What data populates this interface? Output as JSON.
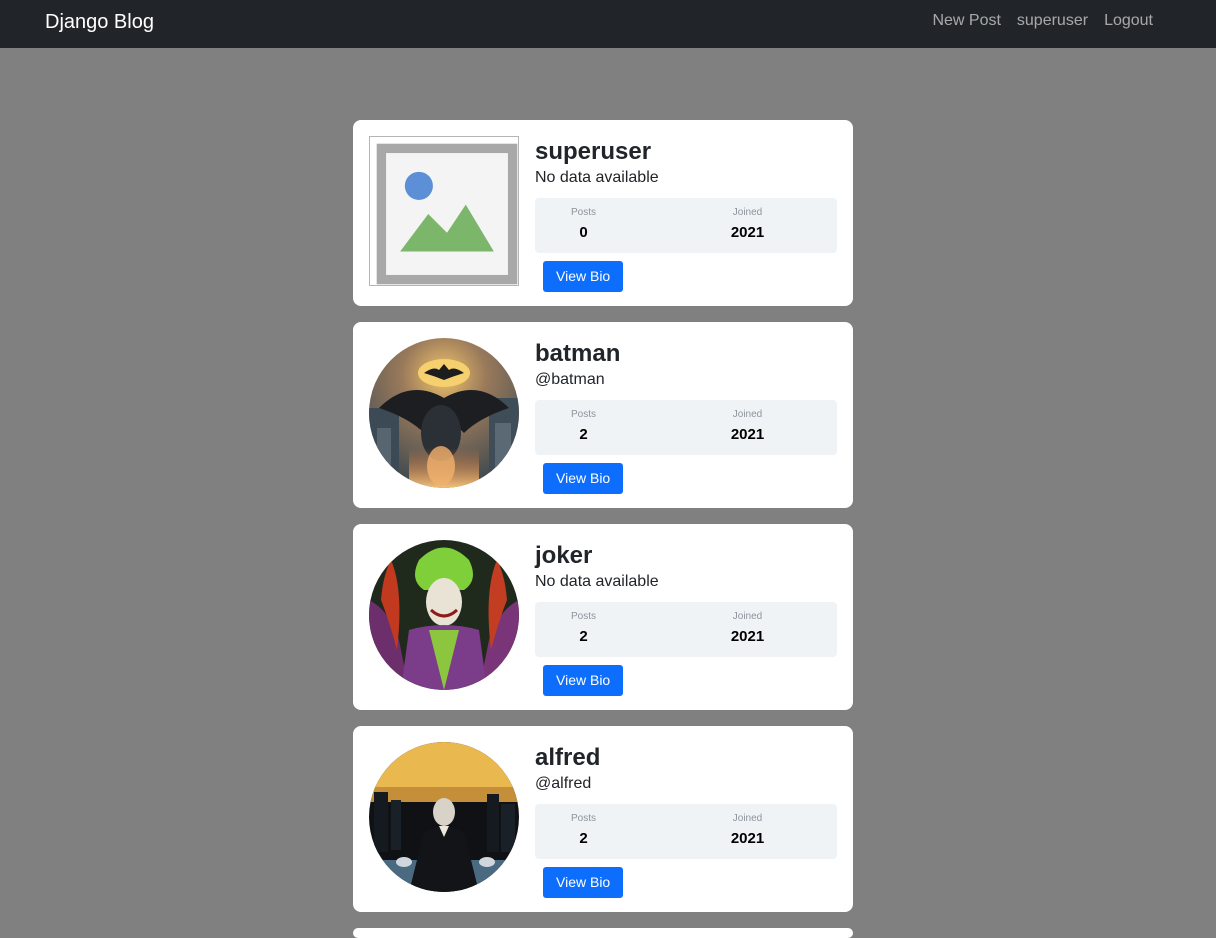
{
  "navbar": {
    "brand": "Django Blog",
    "links": [
      "New Post",
      "superuser",
      "Logout"
    ]
  },
  "profiles": [
    {
      "username": "superuser",
      "subtitle": "No data available",
      "posts_label": "Posts",
      "posts": "0",
      "joined_label": "Joined",
      "joined": "2021",
      "button": "View Bio",
      "avatar": "broken-image"
    },
    {
      "username": "batman",
      "subtitle": "@batman",
      "posts_label": "Posts",
      "posts": "2",
      "joined_label": "Joined",
      "joined": "2021",
      "button": "View Bio",
      "avatar": "batman-portrait"
    },
    {
      "username": "joker",
      "subtitle": "No data available",
      "posts_label": "Posts",
      "posts": "2",
      "joined_label": "Joined",
      "joined": "2021",
      "button": "View Bio",
      "avatar": "joker-portrait"
    },
    {
      "username": "alfred",
      "subtitle": "@alfred",
      "posts_label": "Posts",
      "posts": "2",
      "joined_label": "Joined",
      "joined": "2021",
      "button": "View Bio",
      "avatar": "alfred-portrait"
    }
  ],
  "colors": {
    "navbar_bg": "#212529",
    "page_bg": "#808080",
    "primary_button": "#0d6efd",
    "stats_bg": "#f0f3f6"
  }
}
